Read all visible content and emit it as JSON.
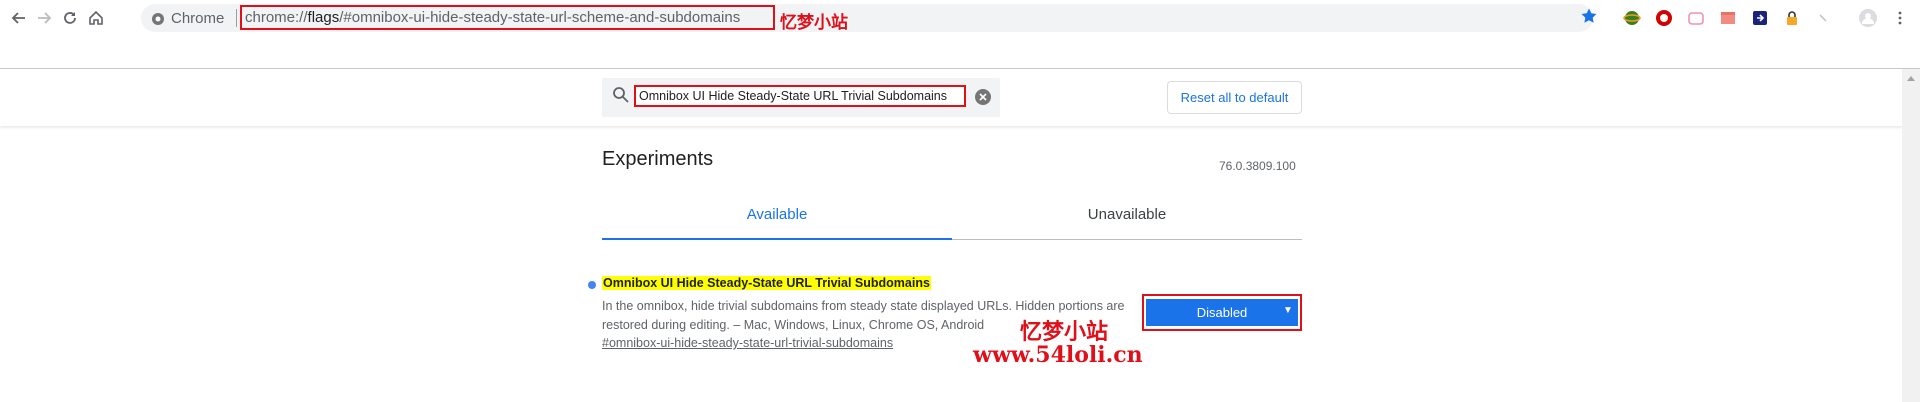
{
  "browser": {
    "chip_label": "Chrome",
    "url_scheme": "chrome://",
    "url_host": "flags",
    "url_path": "/#omnibox-ui-hide-steady-state-url-scheme-and-subdomains",
    "watermark_label": "忆梦小站"
  },
  "icons": {
    "back": "arrow-left-icon",
    "forward": "arrow-right-icon",
    "reload": "reload-icon",
    "home": "home-icon",
    "bookmark": "star-icon",
    "search": "search-icon",
    "clear": "clear-icon"
  },
  "search": {
    "value": "Omnibox UI Hide Steady-State URL Trivial Subdomains"
  },
  "header": {
    "reset_label": "Reset all to default"
  },
  "page": {
    "title": "Experiments",
    "version": "76.0.3809.100",
    "tabs": [
      {
        "label": "Available",
        "active": true
      },
      {
        "label": "Unavailable",
        "active": false
      }
    ]
  },
  "flag": {
    "name": "Omnibox UI Hide Steady-State URL Trivial Subdomains",
    "description": "In the omnibox, hide trivial subdomains from steady state displayed URLs. Hidden portions are restored during editing. – Mac, Windows, Linux, Chrome OS, Android",
    "link": "#omnibox-ui-hide-steady-state-url-trivial-subdomains",
    "state": "Disabled"
  },
  "watermark": {
    "cn": "忆梦小站",
    "site": "www.54loli.cn"
  },
  "colors": {
    "accent": "#1a73e8",
    "highlight": "#ffff00",
    "annotation": "#e0101a"
  }
}
